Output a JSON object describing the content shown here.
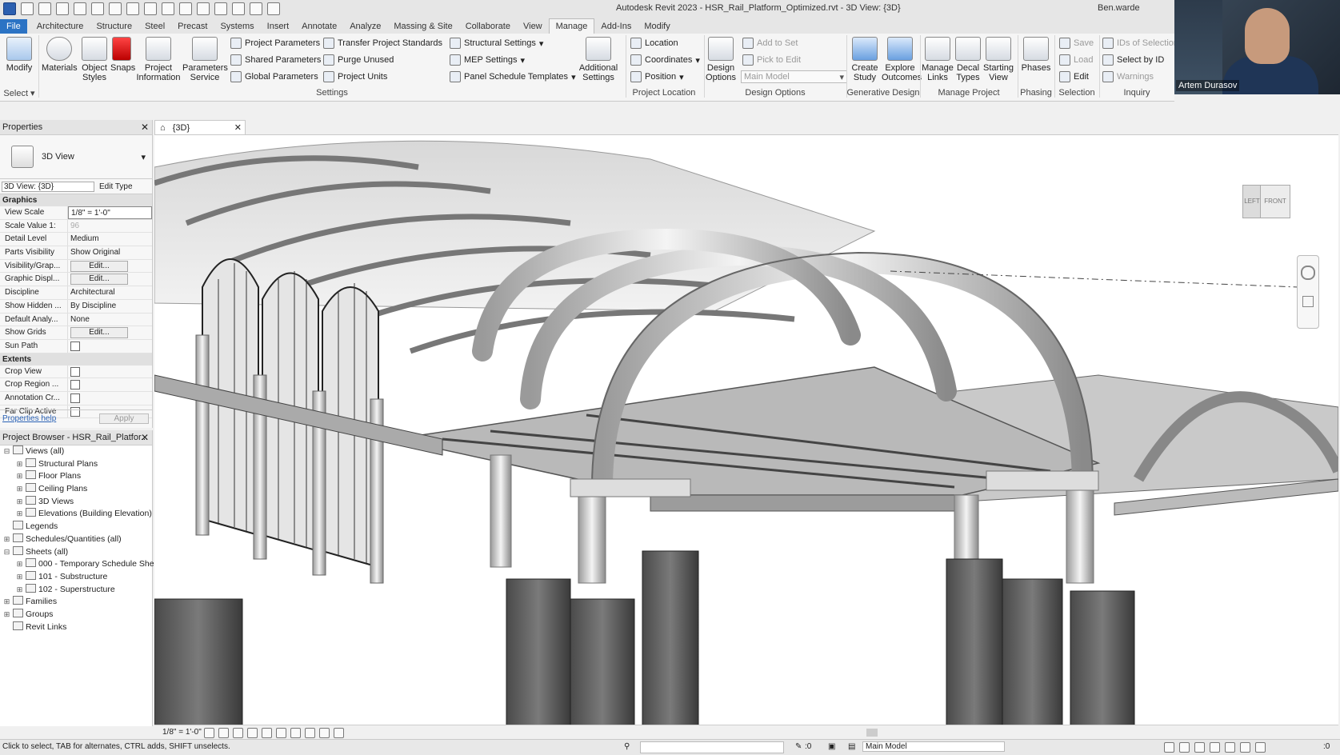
{
  "app": {
    "title": "Autodesk Revit 2023 - HSR_Rail_Platform_Optimized.rvt - 3D View: {3D}",
    "user": "Ben.warde",
    "presenter": "Artem Durasov"
  },
  "tabs": [
    "File",
    "Architecture",
    "Structure",
    "Steel",
    "Precast",
    "Systems",
    "Insert",
    "Annotate",
    "Analyze",
    "Massing & Site",
    "Collaborate",
    "View",
    "Manage",
    "Add-Ins",
    "Modify"
  ],
  "active_tab": "Manage",
  "ribbon": {
    "select": {
      "modify": "Modify",
      "label": "Select"
    },
    "settings": {
      "materials": "Materials",
      "object_styles": "Object Styles",
      "snaps": "Snaps",
      "project_information": "Project Information",
      "parameters_service": "Parameters Service",
      "project_parameters": "Project Parameters",
      "shared_parameters": "Shared Parameters",
      "global_parameters": "Global Parameters",
      "transfer_project_standards": "Transfer Project Standards",
      "purge_unused": "Purge Unused",
      "project_units": "Project Units",
      "structural_settings": "Structural Settings",
      "mep_settings": "MEP Settings",
      "panel_schedule_templates": "Panel Schedule Templates",
      "additional_settings": "Additional Settings",
      "label": "Settings"
    },
    "project_location": {
      "location": "Location",
      "coordinates": "Coordinates",
      "position": "Position",
      "label": "Project Location"
    },
    "design_options": {
      "design_options": "Design Options",
      "add_to_set": "Add to Set",
      "pick_to_edit": "Pick to Edit",
      "main_model": "Main Model",
      "label": "Design Options"
    },
    "generative_design": {
      "create_study": "Create Study",
      "explore_outcomes": "Explore Outcomes",
      "label": "Generative Design"
    },
    "manage_project": {
      "manage_links": "Manage Links",
      "decal_types": "Decal Types",
      "starting_view": "Starting View",
      "label": "Manage Project"
    },
    "phasing": {
      "phases": "Phases",
      "label": "Phasing"
    },
    "selection": {
      "save": "Save",
      "load": "Load",
      "edit": "Edit",
      "label": "Selection"
    },
    "inquiry": {
      "ids_of_selection": "IDs of Selection",
      "select_by_id": "Select by ID",
      "warnings": "Warnings",
      "label": "Inquiry"
    }
  },
  "properties": {
    "title": "Properties",
    "type_name": "3D View",
    "instance_selector": "3D View: {3D}",
    "edit_type": "Edit Type",
    "graphics_label": "Graphics",
    "extents_label": "Extents",
    "rows": [
      {
        "key": "View Scale",
        "value": "1/8\" = 1'-0\""
      },
      {
        "key": "Scale Value  1:",
        "value": "96"
      },
      {
        "key": "Detail Level",
        "value": "Medium"
      },
      {
        "key": "Parts Visibility",
        "value": "Show Original"
      },
      {
        "key": "Visibility/Grap...",
        "value": "Edit..."
      },
      {
        "key": "Graphic Displ...",
        "value": "Edit..."
      },
      {
        "key": "Discipline",
        "value": "Architectural"
      },
      {
        "key": "Show Hidden ...",
        "value": "By Discipline"
      },
      {
        "key": "Default Analy...",
        "value": "None"
      },
      {
        "key": "Show Grids",
        "value": "Edit..."
      },
      {
        "key": "Sun Path",
        "value": ""
      }
    ],
    "extents_rows": [
      {
        "key": "Crop View"
      },
      {
        "key": "Crop Region ..."
      },
      {
        "key": "Annotation Cr..."
      },
      {
        "key": "Far Clip Active"
      }
    ],
    "help_link": "Properties help",
    "apply": "Apply"
  },
  "browser": {
    "title": "Project Browser - HSR_Rail_Platfor...",
    "items": [
      {
        "label": "Views (all)",
        "level": 0,
        "toggle": "−"
      },
      {
        "label": "Structural Plans",
        "level": 1,
        "toggle": "+"
      },
      {
        "label": "Floor Plans",
        "level": 1,
        "toggle": "+"
      },
      {
        "label": "Ceiling Plans",
        "level": 1,
        "toggle": "+"
      },
      {
        "label": "3D Views",
        "level": 1,
        "toggle": "+"
      },
      {
        "label": "Elevations (Building Elevation)",
        "level": 1,
        "toggle": "+"
      },
      {
        "label": "Legends",
        "level": 0,
        "toggle": ""
      },
      {
        "label": "Schedules/Quantities (all)",
        "level": 0,
        "toggle": "+"
      },
      {
        "label": "Sheets (all)",
        "level": 0,
        "toggle": "−"
      },
      {
        "label": "000 - Temporary Schedule Shee",
        "level": 1,
        "toggle": "+"
      },
      {
        "label": "101 - Substructure",
        "level": 1,
        "toggle": "+"
      },
      {
        "label": "102 - Superstructure",
        "level": 1,
        "toggle": "+"
      },
      {
        "label": "Families",
        "level": 0,
        "toggle": "+"
      },
      {
        "label": "Groups",
        "level": 0,
        "toggle": "+"
      },
      {
        "label": "Revit Links",
        "level": 0,
        "toggle": ""
      }
    ]
  },
  "view": {
    "tab_label": "{3D}",
    "viewcube_left": "LEFT",
    "viewcube_front": "FRONT",
    "scale": "1/8\" = 1'-0\""
  },
  "status": {
    "hint": "Click to select, TAB for alternates, CTRL adds, SHIFT unselects.",
    "worksets_count": ":0",
    "model": "Main Model",
    "filter_count": ":0"
  },
  "colors": {
    "file_tab": "#2b73c4",
    "ribbon_bg": "#f5f5f5",
    "viewport_bg": "#ffffff"
  }
}
